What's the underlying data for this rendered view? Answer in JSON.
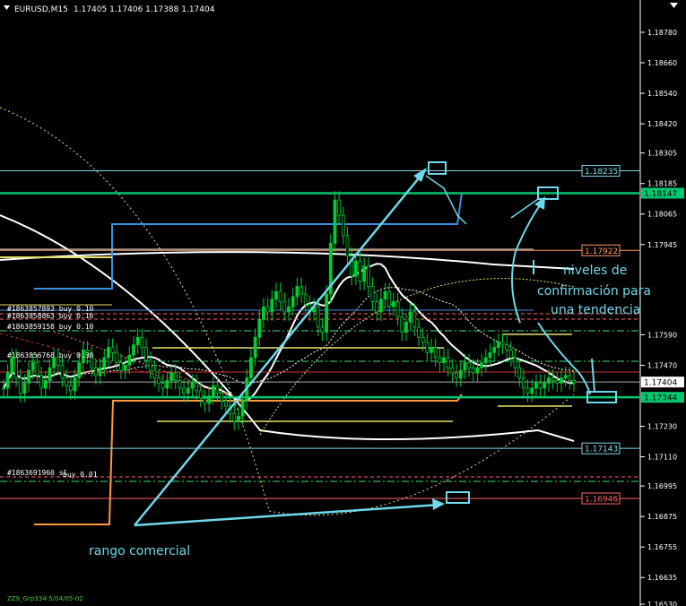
{
  "header": {
    "symbol_timeframe": "EURUSD,M15",
    "ohlc": "1.17405 1.17406 1.17388 1.17404"
  },
  "chart_data": {
    "type": "candlestick",
    "title": "EURUSD,M15",
    "ylim": [
      1.1653,
      1.189
    ],
    "y_ticks": [
      1.1878,
      1.1866,
      1.1854,
      1.1842,
      1.18305,
      1.18185,
      1.18065,
      1.17945,
      1.1759,
      1.1747,
      1.1723,
      1.1711,
      1.16995,
      1.16875,
      1.16755,
      1.16635,
      1.1653
    ],
    "price_labels": [
      {
        "value": "1.18235",
        "price": 1.18235,
        "color": "#7fd8e8"
      },
      {
        "value": "1.18147",
        "price": 1.18147,
        "color": "#00c86e"
      },
      {
        "value": "1.17922",
        "price": 1.17922,
        "color": "#ff9a66"
      },
      {
        "value": "1.17404",
        "price": 1.17404,
        "color": "#ffffff"
      },
      {
        "value": "1.17344",
        "price": 1.17344,
        "color": "#00c86e"
      },
      {
        "value": "1.17143",
        "price": 1.17143,
        "color": "#7fd8e8"
      },
      {
        "value": "1.16946",
        "price": 1.16946,
        "color": "#ff6666"
      }
    ],
    "order_labels": [
      {
        "text": "#1863857893 buy 0.10"
      },
      {
        "text": "#1863858863 buy 0.10"
      },
      {
        "text": "#1863859158 buy 0.10"
      },
      {
        "text": "#1863856768 buy 0.30"
      },
      {
        "text": "#1863691960 sl"
      },
      {
        "text": "buy 0.01"
      }
    ],
    "close_prices": [
      1.1738,
      1.1744,
      1.175,
      1.1742,
      1.1736,
      1.174,
      1.1745,
      1.1748,
      1.1743,
      1.1738,
      1.1741,
      1.1746,
      1.175,
      1.1747,
      1.1742,
      1.1739,
      1.1737,
      1.1742,
      1.1748,
      1.1753,
      1.1751,
      1.1746,
      1.1743,
      1.1746,
      1.175,
      1.1754,
      1.1752,
      1.1748,
      1.1745,
      1.1747,
      1.1751,
      1.1755,
      1.1758,
      1.1754,
      1.1749,
      1.1745,
      1.1742,
      1.174,
      1.1738,
      1.1741,
      1.1744,
      1.1741,
      1.1738,
      1.1736,
      1.1738,
      1.174,
      1.1737,
      1.1734,
      1.1732,
      1.1735,
      1.1739,
      1.1736,
      1.1733,
      1.1731,
      1.1728,
      1.1725,
      1.1727,
      1.1733,
      1.1742,
      1.175,
      1.1758,
      1.1765,
      1.177,
      1.1768,
      1.1773,
      1.1776,
      1.1772,
      1.1768,
      1.177,
      1.1774,
      1.1778,
      1.1775,
      1.1771,
      1.1768,
      1.177,
      1.1762,
      1.176,
      1.1775,
      1.1795,
      1.1812,
      1.1806,
      1.1798,
      1.179,
      1.1782,
      1.1788,
      1.178,
      1.1786,
      1.1778,
      1.1772,
      1.1768,
      1.1773,
      1.1776,
      1.177,
      1.1772,
      1.1766,
      1.176,
      1.1764,
      1.1768,
      1.1762,
      1.1758,
      1.1756,
      1.1752,
      1.1754,
      1.175,
      1.1748,
      1.175,
      1.1746,
      1.1744,
      1.1742,
      1.1745,
      1.1748,
      1.1746,
      1.1744,
      1.1746,
      1.1748,
      1.175,
      1.1752,
      1.1754,
      1.1756,
      1.1755,
      1.1753,
      1.175,
      1.1746,
      1.1742,
      1.1738,
      1.1736,
      1.1738,
      1.174,
      1.1738,
      1.174,
      1.1742,
      1.1741,
      1.174,
      1.1742,
      1.1743,
      1.1741,
      1.174
    ],
    "h_lines": [
      {
        "price": 1.18235,
        "color": "#7fd8e8",
        "style": "solid"
      },
      {
        "price": 1.18147,
        "color": "#00c86e",
        "style": "solid-thick"
      },
      {
        "price": 1.17922,
        "color": "#ff9a66",
        "style": "solid"
      },
      {
        "price": 1.17344,
        "color": "#00c86e",
        "style": "solid-thick"
      },
      {
        "price": 1.17143,
        "color": "#7fd8e8",
        "style": "solid"
      },
      {
        "price": 1.16946,
        "color": "#ff6666",
        "style": "solid"
      },
      {
        "price": 1.17404,
        "color": "#aaaaaa",
        "style": "solid"
      }
    ],
    "annotations": {
      "note_text_1": "niveles de",
      "note_text_2": "confirmación para",
      "note_text_3": "una tendencia",
      "range_text": "rango comercial"
    },
    "grid": false
  },
  "footer": {
    "indicator_text": "ZZ9_Grp334-5/04/05-02"
  },
  "colors": {
    "background": "#000000",
    "bull_candle": "#00cc33",
    "annotation": "#6fd8ea",
    "text": "#ffffff"
  }
}
